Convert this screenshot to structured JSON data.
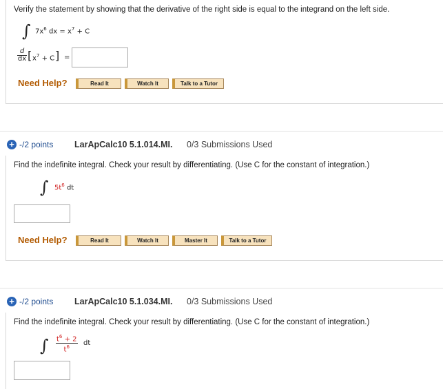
{
  "q1": {
    "instruction": "Verify the statement by showing that the derivative of the right side is equal to the integrand on the left side.",
    "integrand_coef": "7x",
    "integrand_exp": "6",
    "dx": "dx",
    "equals": "=",
    "rhs_base": "x",
    "rhs_exp": "7",
    "rhs_tail": "+ C",
    "deriv_num": "d",
    "deriv_den": "dx",
    "bracket_base": "x",
    "bracket_exp": "7",
    "bracket_tail": "+ C",
    "deriv_equals": "=",
    "answer_value": "",
    "help_label": "Need Help?",
    "buttons": [
      "Read It",
      "Watch It",
      "Talk to a Tutor"
    ]
  },
  "q2": {
    "points": "-/2 points",
    "code": "LarApCalc10 5.1.014.MI.",
    "submissions": "0/3 Submissions Used",
    "instruction": "Find the indefinite integral. Check your result by differentiating. (Use C for the constant of integration.)",
    "integrand_base": "5t",
    "integrand_exp": "6",
    "dt": "dt",
    "answer_value": "",
    "help_label": "Need Help?",
    "buttons": [
      "Read It",
      "Watch It",
      "Master It",
      "Talk to a Tutor"
    ]
  },
  "q3": {
    "points": "-/2 points",
    "code": "LarApCalc10 5.1.034.MI.",
    "submissions": "0/3 Submissions Used",
    "instruction": "Find the indefinite integral. Check your result by differentiating. (Use C for the constant of integration.)",
    "num_base": "t",
    "num_exp": "6",
    "num_tail": "+ 2",
    "den_base": "t",
    "den_exp": "6",
    "dt": "dt",
    "answer_value": ""
  },
  "colors": {
    "need_help": "#b25a00",
    "button_fill": "#f7e2bd",
    "plus_icon": "#2a64b6",
    "points_text": "#1f4c8f",
    "red_text": "#d02020"
  }
}
